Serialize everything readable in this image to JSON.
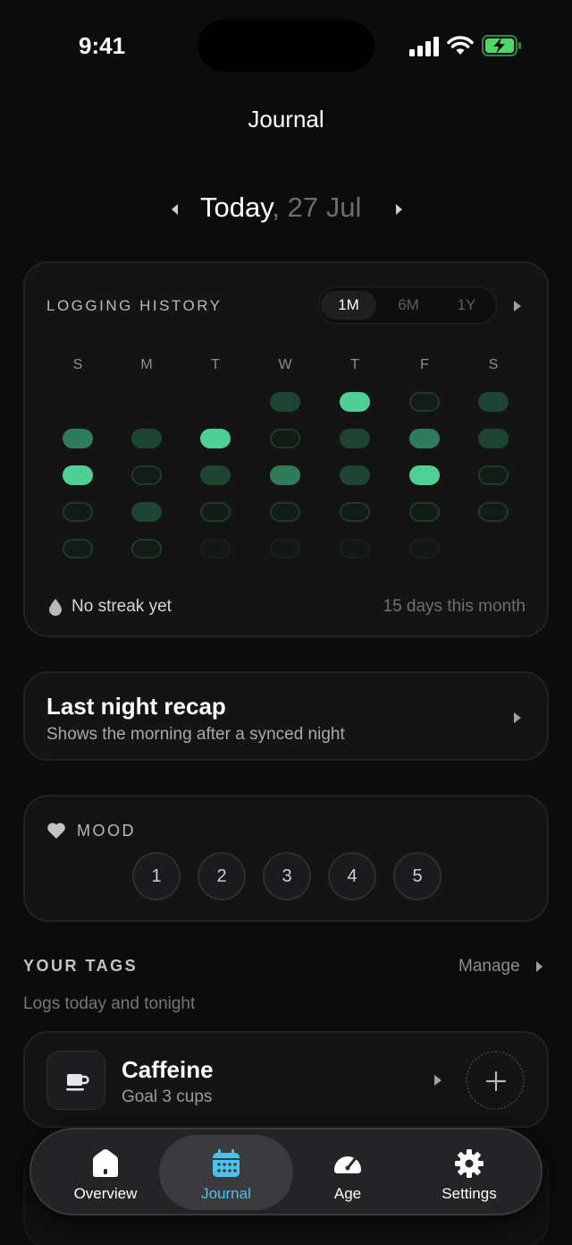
{
  "status_bar": {
    "time": "9:41"
  },
  "header": {
    "title": "Journal"
  },
  "date_nav": {
    "today": "Today",
    "separator": ",",
    "date": "27 Jul"
  },
  "logging_history": {
    "title": "LOGGING HISTORY",
    "ranges": [
      "1M",
      "6M",
      "1Y"
    ],
    "selected_range": "1M",
    "weekdays": [
      "S",
      "M",
      "T",
      "W",
      "T",
      "F",
      "S"
    ],
    "levels_legend": [
      "bright",
      "mid",
      "dark",
      "outline",
      "faint"
    ],
    "grid": [
      [
        null,
        null,
        null,
        "dark",
        "bright",
        "outline",
        "dark"
      ],
      [
        "mid",
        "dark",
        "bright",
        "outline",
        "dark",
        "mid",
        "dark"
      ],
      [
        "bright",
        "outline",
        "dark",
        "mid",
        "dark",
        "bright",
        "outline"
      ],
      [
        "outline",
        "dark",
        "outline",
        "outline",
        "outline",
        "outline",
        "outline"
      ],
      [
        "outline",
        "outline",
        "faint",
        "faint",
        "faint",
        "faint",
        null
      ]
    ],
    "streak_text": "No streak yet",
    "month_count_text": "15 days this month"
  },
  "recap": {
    "title": "Last night recap",
    "subtitle": "Shows the morning after a synced night"
  },
  "mood": {
    "label": "MOOD",
    "options": [
      "1",
      "2",
      "3",
      "4",
      "5"
    ]
  },
  "tags": {
    "title": "YOUR TAGS",
    "manage_label": "Manage",
    "subtitle": "Logs today and tonight",
    "items": [
      {
        "name": "Caffeine",
        "goal": "Goal 3 cups",
        "icon": "coffee-cup-icon"
      }
    ]
  },
  "tab_bar": {
    "active": "Journal",
    "items": [
      {
        "label": "Overview",
        "icon": "home-icon"
      },
      {
        "label": "Journal",
        "icon": "calendar-icon"
      },
      {
        "label": "Age",
        "icon": "gauge-icon"
      },
      {
        "label": "Settings",
        "icon": "gear-icon"
      }
    ]
  },
  "colors": {
    "accent_tab": "#4cc3ec",
    "cell_bright": "#4ed095",
    "cell_mid": "#2f7c5b",
    "cell_dark": "#1e4434",
    "battery": "#4cd964"
  }
}
